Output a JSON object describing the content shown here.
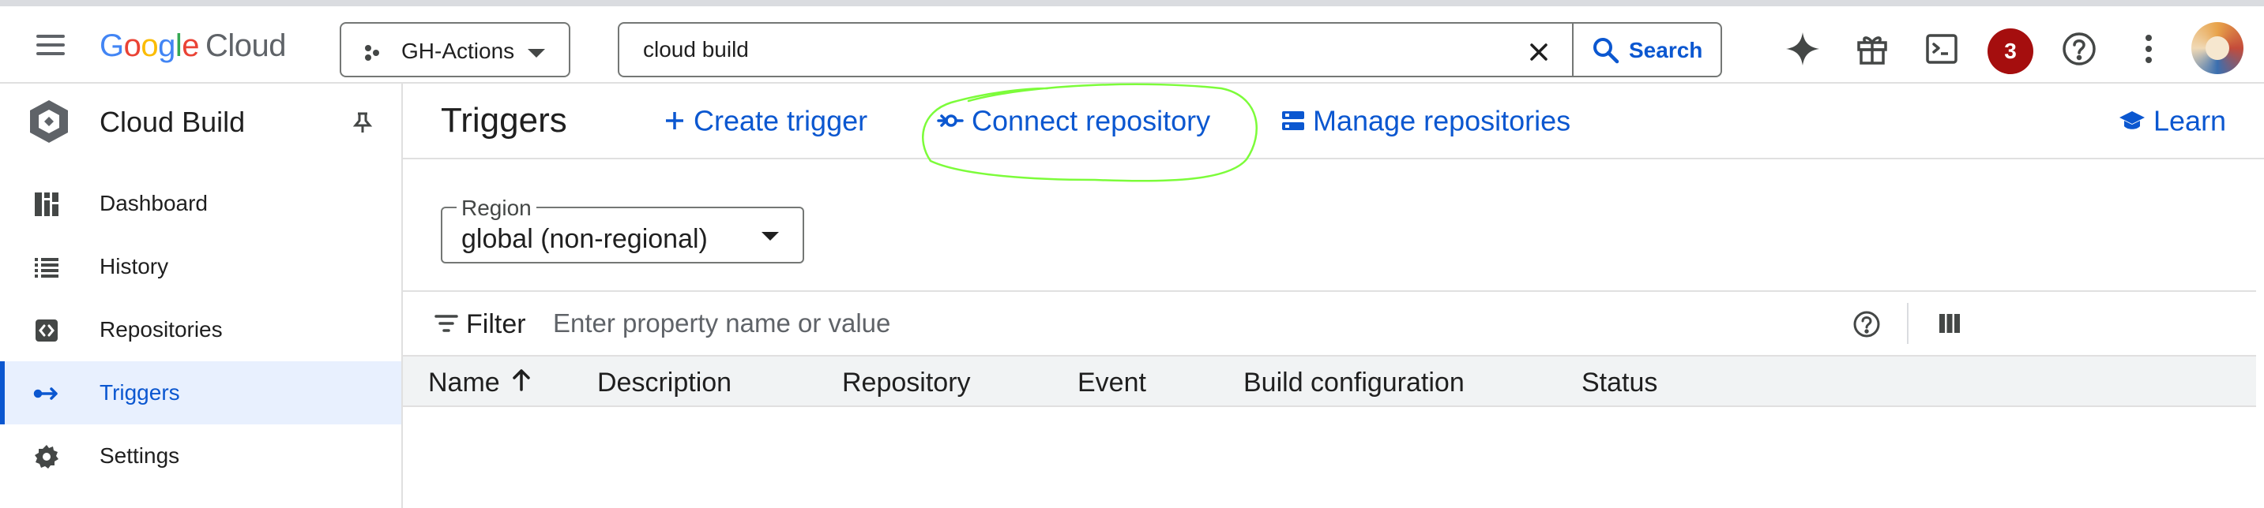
{
  "topbar": {
    "logo": {
      "g": "G",
      "o1": "o",
      "o2": "o",
      "g2": "g",
      "l": "l",
      "e": "e",
      "product": "Cloud"
    },
    "project": {
      "name": "GH-Actions"
    },
    "search": {
      "value": "cloud build",
      "button_label": "Search"
    },
    "notifications_count": "3",
    "icons": [
      "menu-icon",
      "gemini-sparkle-icon",
      "gift-icon",
      "cloud-shell-icon",
      "help-icon",
      "more-vert-icon"
    ]
  },
  "sidebar": {
    "title": "Cloud Build",
    "items": [
      {
        "label": "Dashboard",
        "icon": "dashboard-icon",
        "active": false
      },
      {
        "label": "History",
        "icon": "list-icon",
        "active": false
      },
      {
        "label": "Repositories",
        "icon": "code-icon",
        "active": false
      },
      {
        "label": "Triggers",
        "icon": "trigger-arrows-icon",
        "active": true
      },
      {
        "label": "Settings",
        "icon": "gear-icon",
        "active": false
      }
    ]
  },
  "main": {
    "title": "Triggers",
    "actions": {
      "create_trigger": "Create trigger",
      "connect_repository": "Connect repository",
      "manage_repositories": "Manage repositories",
      "learn": "Learn"
    },
    "region": {
      "label": "Region",
      "value": "global (non-regional)"
    },
    "filter": {
      "label": "Filter",
      "placeholder": "Enter property name or value"
    },
    "table": {
      "columns": [
        "Name",
        "Description",
        "Repository",
        "Event",
        "Build configuration",
        "Status"
      ],
      "sort_column": "Name",
      "sort_direction": "ascending",
      "rows": []
    }
  },
  "colors": {
    "accent": "#0b57d0",
    "active_nav_bg": "#e8f0fe",
    "badge": "#a50e0e",
    "annotation": "#7cfc3a"
  }
}
